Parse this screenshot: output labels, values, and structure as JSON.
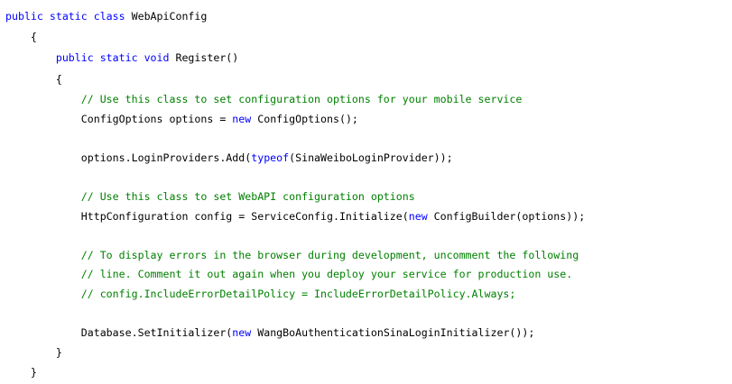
{
  "code": {
    "line1": {
      "kw1": "public static class",
      "name": " WebApiConfig"
    },
    "line2": {
      "text": "    {"
    },
    "line3": {
      "indent": "        ",
      "kw": "public static void",
      "name": " Register()"
    },
    "line4": {
      "text": "        {"
    },
    "line5": {
      "indent": "            ",
      "comment": "// Use this class to set configuration options for your mobile service"
    },
    "line6": {
      "indent": "            ",
      "a": "ConfigOptions options = ",
      "kw": "new",
      "b": " ConfigOptions();"
    },
    "line7": {
      "indent": "            ",
      "a": "options.LoginProviders.Add(",
      "kw": "typeof",
      "b": "(SinaWeiboLoginProvider));"
    },
    "line8": {
      "indent": "            ",
      "comment": "// Use this class to set WebAPI configuration options"
    },
    "line9": {
      "indent": "            ",
      "a": "HttpConfiguration config = ServiceConfig.Initialize(",
      "kw": "new",
      "b": " ConfigBuilder(options));"
    },
    "line10": {
      "indent": "            ",
      "comment": "// To display errors in the browser during development, uncomment the following"
    },
    "line11": {
      "indent": "            ",
      "comment": "// line. Comment it out again when you deploy your service for production use."
    },
    "line12": {
      "indent": "            ",
      "comment": "// config.IncludeErrorDetailPolicy = IncludeErrorDetailPolicy.Always;"
    },
    "line13": {
      "indent": "            ",
      "a": "Database.SetInitializer(",
      "kw": "new",
      "b": " WangBoAuthenticationSinaLoginInitializer());"
    },
    "line14": {
      "text": "        }"
    },
    "line15": {
      "text": "    }"
    }
  }
}
